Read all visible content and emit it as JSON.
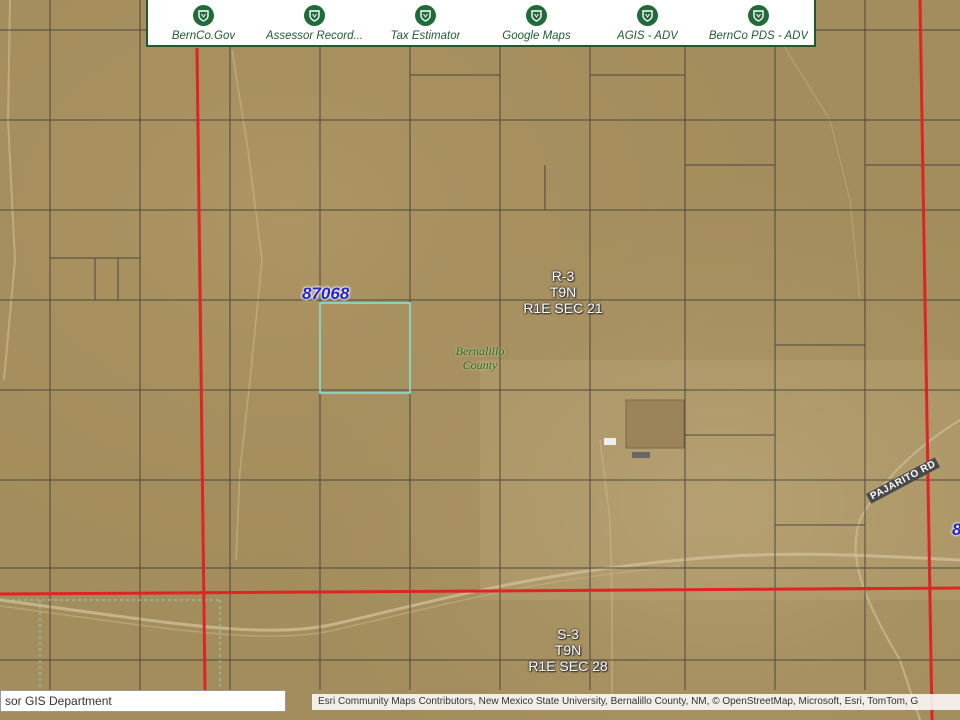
{
  "toolbar": {
    "items": [
      {
        "label": "BernCo.Gov",
        "icon": "shield-icon"
      },
      {
        "label": "Assessor Record...",
        "icon": "shield-icon"
      },
      {
        "label": "Tax Estimator",
        "icon": "shield-icon"
      },
      {
        "label": "Google Maps",
        "icon": "shield-icon"
      },
      {
        "label": "AGIS - ADV",
        "icon": "shield-icon"
      },
      {
        "label": "BernCo PDS - ADV",
        "icon": "shield-icon"
      }
    ]
  },
  "map": {
    "parcel_number": "87068",
    "parcel_number_edge": "8",
    "county_label": [
      "Bernalillo",
      "County"
    ],
    "sections": [
      {
        "zone": "R-3",
        "township": "T9N",
        "range_section": "R1E SEC 21"
      },
      {
        "zone": "S-3",
        "township": "T9N",
        "range_section": "R1E SEC 28"
      }
    ],
    "road_label": "PAJARITO RD",
    "colors": {
      "terrain": "#a48d5c",
      "section_line": "#e02424",
      "parcel_line": "#3b3b3b",
      "selected_parcel": "#7fe8d8"
    }
  },
  "footer": {
    "left_text": "sor GIS Department",
    "attribution": "Esri Community Maps Contributors, New Mexico State University, Bernalillo County, NM, © OpenStreetMap, Microsoft, Esri, TomTom, G"
  }
}
